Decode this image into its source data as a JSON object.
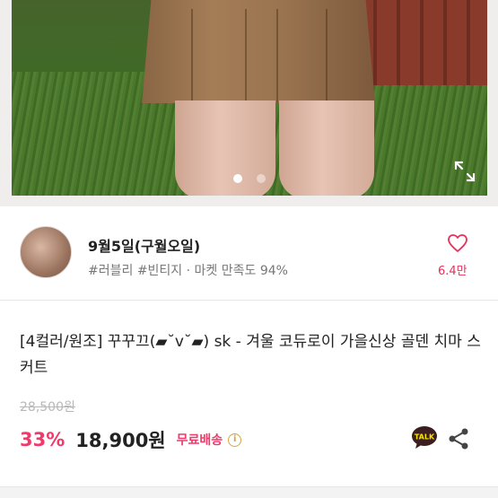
{
  "gallery": {
    "slide_count": 2,
    "active_slide": 1
  },
  "seller": {
    "name": "9월5일(구월오일)",
    "tags": "#러블리 #빈티지 · 마켓 만족도 94%",
    "like_count": "6.4만",
    "heart_icon": "heart-outline-icon",
    "like_color": "#e8305a"
  },
  "product": {
    "title": "[4컬러/원조] 꾸꾸끄(▰˘v˘▰) sk - 겨울 코듀로이 가을신상 골덴 치마 스커트",
    "original_price": "28,500원",
    "discount": "33%",
    "price": "18,900원",
    "shipping": "무료배송",
    "info_icon": "i",
    "talk_label": "TALK"
  },
  "colors": {
    "accent": "#ef3a6b",
    "talk_bg": "#3c1e1e"
  }
}
